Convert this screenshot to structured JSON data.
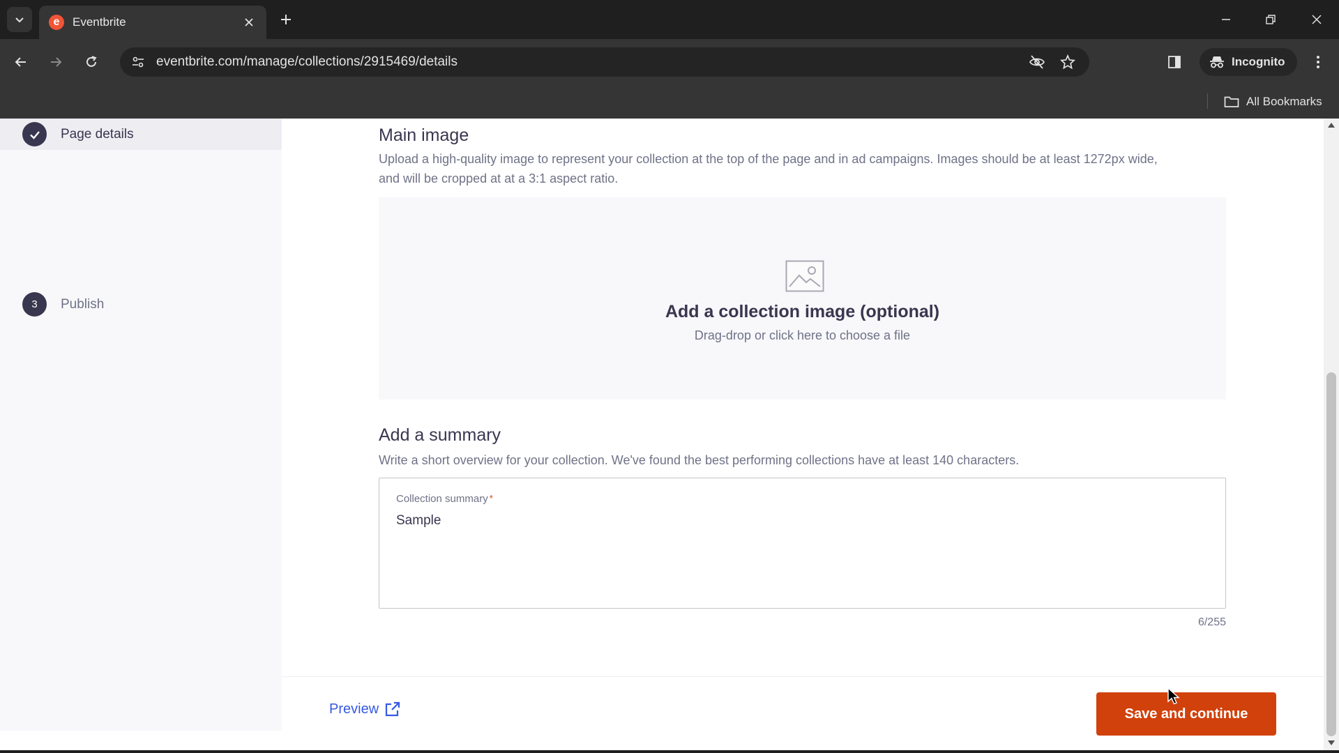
{
  "browser": {
    "tab_title": "Eventbrite",
    "tab_logo_letter": "e",
    "url": "eventbrite.com/manage/collections/2915469/details",
    "incognito_label": "Incognito",
    "all_bookmarks_label": "All Bookmarks"
  },
  "sidebar": {
    "steps": [
      {
        "label": "Page details",
        "state": "completed",
        "icon": "check-icon"
      },
      {
        "label": "Publish",
        "state": "pending",
        "number": "3"
      }
    ]
  },
  "main_image": {
    "heading": "Main image",
    "description_line1": "Upload a high-quality image to represent your collection at the top of the page and in ad campaigns. Images should be at least 1272px wide,",
    "description_line2": "and will be cropped at at a 3:1 aspect ratio.",
    "dropzone_title": "Add a collection image (optional)",
    "dropzone_subtitle": "Drag-drop or click here to choose a file",
    "icon": "image-placeholder-icon"
  },
  "summary": {
    "heading": "Add a summary",
    "description": "Write a short overview for your collection. We've found the best performing collections have at least 140 characters.",
    "field_label": "Collection summary",
    "required_mark": "*",
    "value": "Sample",
    "counter": "6/255"
  },
  "footer": {
    "preview_label": "Preview",
    "save_label": "Save and continue"
  },
  "colors": {
    "brand": "#f05537",
    "primary_button": "#d1410c",
    "link": "#3659e3",
    "text_dark": "#39364f",
    "text_muted": "#6f7287"
  }
}
